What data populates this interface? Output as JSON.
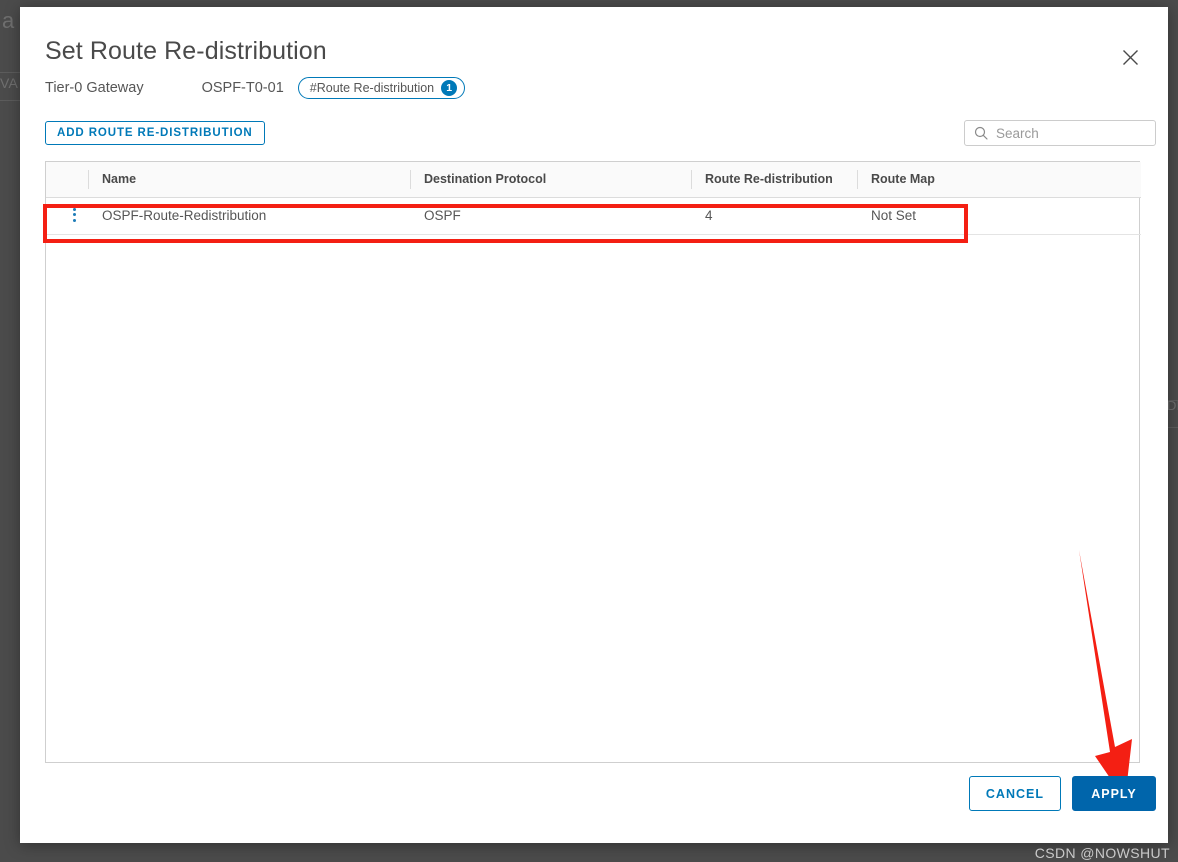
{
  "modal": {
    "title": "Set Route Re-distribution",
    "close_icon": "close-icon",
    "subheader": {
      "gateway_type": "Tier-0 Gateway",
      "gateway_name": "OSPF-T0-01",
      "chip_label": "#Route Re-distribution",
      "chip_count": "1"
    },
    "toolbar": {
      "add_label": "ADD ROUTE RE-DISTRIBUTION",
      "search_placeholder": "Search",
      "search_value": "",
      "search_icon": "search-icon"
    },
    "table": {
      "columns": [
        "Name",
        "Destination Protocol",
        "Route Re-distribution",
        "Route Map"
      ],
      "rows": [
        {
          "kebab": "kebab-menu-icon",
          "name": "OSPF-Route-Redistribution",
          "destination_protocol": "OSPF",
          "route_redistribution": "4",
          "route_map": "Not Set"
        }
      ]
    },
    "footer": {
      "cancel_label": "CANCEL",
      "apply_label": "APPLY"
    }
  },
  "annotations": {
    "highlight_color": "#f41f13",
    "arrow_color": "#f41f13",
    "arrow_target": "apply-button"
  },
  "watermark": "CSDN @NOWSHUT",
  "background": {
    "overlay_color": "#4b4b4b",
    "fragments": [
      "a",
      "VA",
      "DP"
    ]
  },
  "colors": {
    "accent": "#0079b8",
    "primary_button": "#0065ab",
    "text": "#565656",
    "heading": "#4a4a4a"
  }
}
